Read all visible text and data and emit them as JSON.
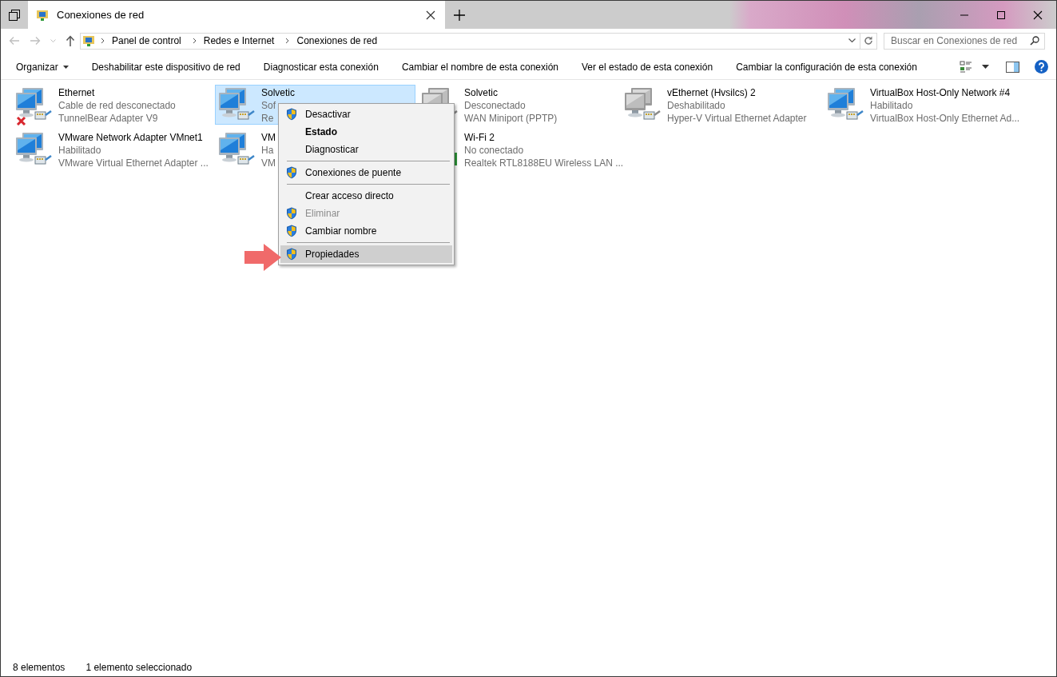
{
  "window": {
    "tab_title": "Conexiones de red"
  },
  "address": {
    "crumbs": [
      "Panel de control",
      "Redes e Internet",
      "Conexiones de red"
    ]
  },
  "search": {
    "placeholder": "Buscar en Conexiones de red"
  },
  "toolbar": {
    "buttons": [
      {
        "label": "Organizar",
        "kind": "dropdown"
      },
      {
        "label": "Deshabilitar este dispositivo de red",
        "kind": "plain"
      },
      {
        "label": "Diagnosticar esta conexión",
        "kind": "plain"
      },
      {
        "label": "Cambiar el nombre de esta conexión",
        "kind": "plain"
      },
      {
        "label": "Ver el estado de esta conexión",
        "kind": "plain"
      },
      {
        "label": "Cambiar la configuración de esta conexión",
        "kind": "plain"
      }
    ]
  },
  "connections": [
    {
      "name": "Ethernet",
      "status": "Cable de red desconectado",
      "adapter": "TunnelBear Adapter V9",
      "kind": "cable-error",
      "selected": false
    },
    {
      "name": "Solvetic",
      "status": "Sof",
      "adapter": "Re",
      "kind": "enabled",
      "selected": true
    },
    {
      "name": "Solvetic",
      "status": "Desconectado",
      "adapter": "WAN Miniport (PPTP)",
      "kind": "disabled",
      "selected": false
    },
    {
      "name": "vEthernet (Hvsilcs) 2",
      "status": "Deshabilitado",
      "adapter": "Hyper-V Virtual Ethernet Adapter",
      "kind": "disabled",
      "selected": false
    },
    {
      "name": "VirtualBox Host-Only Network #4",
      "status": "Habilitado",
      "adapter": "VirtualBox Host-Only Ethernet Ad...",
      "kind": "enabled",
      "selected": false
    },
    {
      "name": "VMware Network Adapter VMnet1",
      "status": "Habilitado",
      "adapter": "VMware Virtual Ethernet Adapter ...",
      "kind": "enabled",
      "selected": false
    },
    {
      "name": "VM",
      "status": "Ha",
      "adapter": "VM",
      "kind": "enabled",
      "selected": false
    },
    {
      "name": "Wi-Fi 2",
      "status": "No conectado",
      "adapter": "Realtek RTL8188EU Wireless LAN ...",
      "kind": "wifi",
      "selected": false
    }
  ],
  "context_menu": {
    "items": [
      {
        "kind": "command",
        "label": "Desactivar",
        "shield": true,
        "default": false,
        "disabled": false,
        "selected": false
      },
      {
        "kind": "command",
        "label": "Estado",
        "shield": false,
        "default": true,
        "disabled": false,
        "selected": false
      },
      {
        "kind": "command",
        "label": "Diagnosticar",
        "shield": false,
        "default": false,
        "disabled": false,
        "selected": false
      },
      {
        "kind": "separator"
      },
      {
        "kind": "command",
        "label": "Conexiones de puente",
        "shield": true,
        "default": false,
        "disabled": false,
        "selected": false
      },
      {
        "kind": "separator"
      },
      {
        "kind": "command",
        "label": "Crear acceso directo",
        "shield": false,
        "default": false,
        "disabled": false,
        "selected": false
      },
      {
        "kind": "command",
        "label": "Eliminar",
        "shield": true,
        "default": false,
        "disabled": true,
        "selected": false
      },
      {
        "kind": "command",
        "label": "Cambiar nombre",
        "shield": true,
        "default": false,
        "disabled": false,
        "selected": false
      },
      {
        "kind": "separator"
      },
      {
        "kind": "command",
        "label": "Propiedades",
        "shield": true,
        "default": false,
        "disabled": false,
        "selected": true
      }
    ]
  },
  "status_bar": {
    "count": "8 elementos",
    "selection": "1 elemento seleccionado"
  }
}
